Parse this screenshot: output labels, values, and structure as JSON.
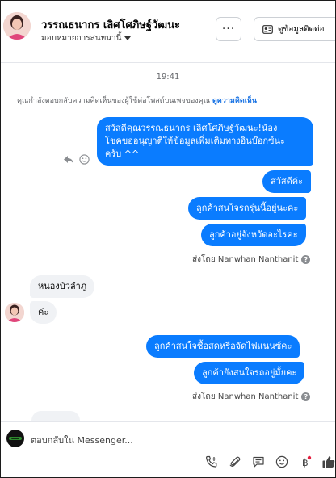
{
  "header": {
    "contact_name": "วรรณธนากร เลิศโศภิษฐ์วัฒนะ",
    "assign_label": "มอบหมายการสนทนานี้",
    "more_label": "···",
    "contact_info_label": "ดูข้อมูลติดต่อ"
  },
  "conversation": {
    "timestamp": "19:41",
    "context_text": "คุณกำลังตอบกลับความคิดเห็นของผู้ใช้ต่อโพสต์บนเพจของคุณ",
    "context_link": "ดูความคิดเห็น",
    "messages_group1": [
      "สวัสดีคุณวรรณธนากร เลิศโศภิษฐ์วัฒนะ!น้อง",
      "โชคขออนุญาติให้ข้อมูลเพิ่มเติมทางอินบ๊อกซ์นะ",
      "ครับ ^^"
    ],
    "msg_hello": "สวัสดีค่ะ",
    "msg_interest": "ลูกค้าสนใจรถรุ่นนี้อยู่นะคะ",
    "msg_province": "ลูกค้าอยู่จังหวัดอะไรคะ",
    "sent_by_1": "ส่งโดย Nanwhan Nanthanit",
    "incoming_1": "หนองบัวลำภู",
    "incoming_2": "ค่ะ",
    "msg_cash": "ลูกค้าสนใจซื้อสดหรือจัดไฟแนนซ์คะ",
    "msg_still": "ลูกค้ายังสนใจรถอยู่มั้ยคะ",
    "sent_by_2": "ส่งโดย Nanwhan Nanthanit"
  },
  "footer": {
    "reply_placeholder": "ตอบกลับใน Messenger..."
  },
  "colors": {
    "outgoing_bubble": "#0a7cff",
    "incoming_bubble": "#f0f2f5",
    "link": "#1b74e4"
  },
  "icons": [
    "more-icon",
    "contact-card-icon",
    "reply-icon",
    "emoji-icon",
    "help-icon",
    "call-add-icon",
    "attachment-icon",
    "saved-reply-icon",
    "emoji-icon",
    "currency-icon",
    "like-icon"
  ]
}
